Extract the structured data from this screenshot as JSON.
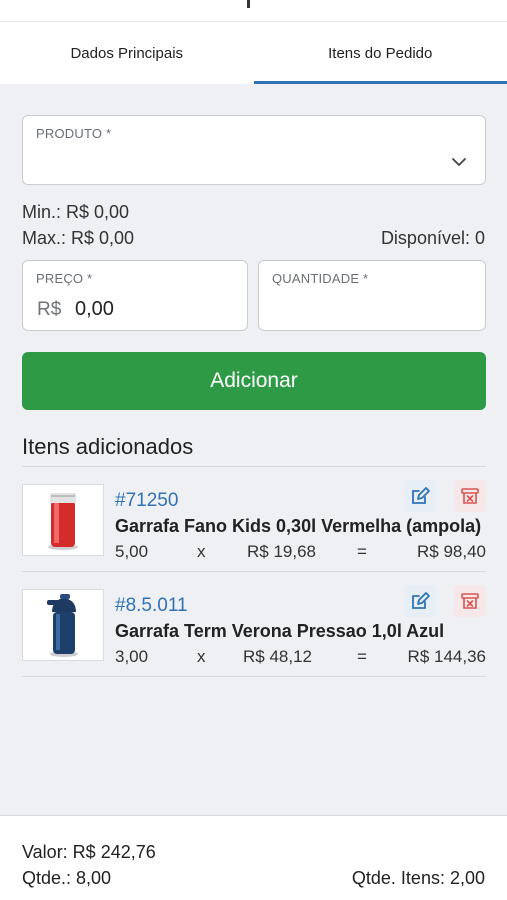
{
  "tabs": [
    {
      "label": "Dados Principais",
      "active": false
    },
    {
      "label": "Itens do Pedido",
      "active": true
    }
  ],
  "form": {
    "produto_label": "PRODUTO *",
    "produto_value": "",
    "min_text": "Min.: R$ 0,00",
    "max_text": "Max.: R$ 0,00",
    "disponivel_text": "Disponível: 0",
    "preco_label": "PREÇO *",
    "preco_prefix": "R$",
    "preco_value": "0,00",
    "quantidade_label": "QUANTIDADE *",
    "quantidade_value": "",
    "add_button": "Adicionar"
  },
  "items_section": {
    "title": "Itens adicionados",
    "items": [
      {
        "code": "#71250",
        "name": "Garrafa Fano Kids 0,30l Vermelha (ampola)",
        "qty": "5,00",
        "times": "x",
        "unit_price": "R$ 19,68",
        "equals": "=",
        "total": "R$ 98,40",
        "thumb_icon": "red-thermos-bottle-image"
      },
      {
        "code": "#8.5.011",
        "name": "Garrafa Term  Verona Pressao 1,0l Azul",
        "qty": "3,00",
        "times": "x",
        "unit_price": "R$ 48,12",
        "equals": "=",
        "total": "R$ 144,36",
        "thumb_icon": "blue-pump-thermos-image"
      }
    ]
  },
  "footer": {
    "valor": "Valor: R$ 242,76",
    "qtde": "Qtde.: 8,00",
    "qtde_itens": "Qtde. Itens: 2,00"
  },
  "colors": {
    "accent": "#2f73b5",
    "add_button": "#2e9a45",
    "delete_icon": "#d9534f"
  }
}
